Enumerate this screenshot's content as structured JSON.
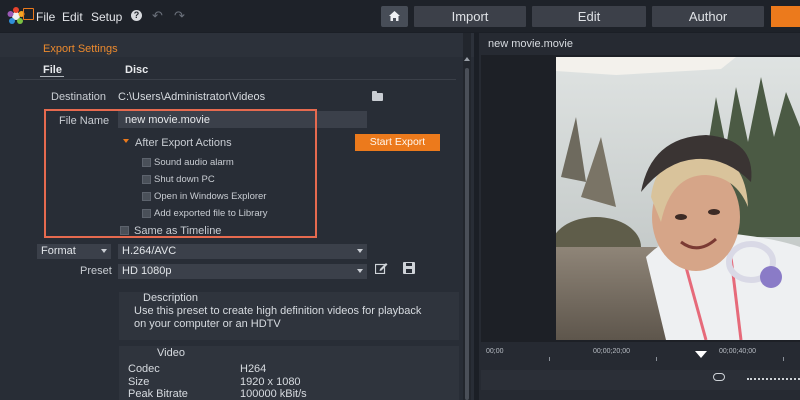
{
  "menu": [
    "File",
    "Edit",
    "Setup"
  ],
  "tabs": [
    "Import",
    "Edit",
    "Author"
  ],
  "panel_title": "Export Settings",
  "subtabs": [
    "File",
    "Disc"
  ],
  "destination": {
    "label": "Destination",
    "value": "C:\\Users\\Administrator\\Videos"
  },
  "file_name": {
    "label": "File Name",
    "value": "new movie.movie"
  },
  "after_export": {
    "label": "After Export Actions",
    "options": [
      "Sound audio alarm",
      "Shut down PC",
      "Open in Windows Explorer",
      "Add exported file to Library"
    ]
  },
  "start_export": "Start Export",
  "same_as_timeline": "Same as Timeline",
  "format": {
    "label": "Format",
    "value": "H.264/AVC"
  },
  "preset": {
    "label": "Preset",
    "value": "HD 1080p"
  },
  "description": {
    "title": "Description",
    "text": "Use this preset to create high definition videos for playback on your computer or an HDTV"
  },
  "video": {
    "title": "Video",
    "specs": [
      {
        "key": "Codec",
        "value": "H264"
      },
      {
        "key": "Size",
        "value": "1920 x 1080"
      },
      {
        "key": "Peak Bitrate",
        "value": "100000 kBit/s"
      }
    ]
  },
  "preview_title": "new movie.movie",
  "timeline_ticks": [
    "00;00",
    "00;00;20;00",
    "00;00;40;00"
  ],
  "colors": {
    "accent": "#ec7a1c",
    "highlight_box": "#e66a4f"
  }
}
